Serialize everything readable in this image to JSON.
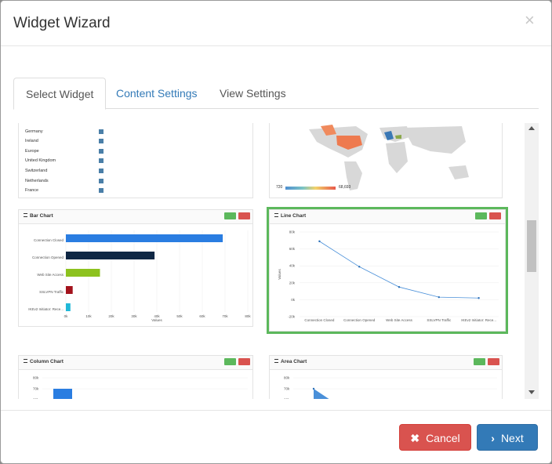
{
  "dialog": {
    "title": "Widget Wizard",
    "close_label": "×"
  },
  "tabs": [
    {
      "label": "Select Widget",
      "active": true
    },
    {
      "label": "Content Settings",
      "active": false
    },
    {
      "label": "View Settings",
      "active": false
    }
  ],
  "widgets": {
    "map_list": {
      "rows": [
        "Germany",
        "Ireland",
        "Europe",
        "United Kingdom",
        "Switzerland",
        "Netherlands",
        "France"
      ]
    },
    "world_map": {
      "legend_min": "720",
      "legend_max": "68,693"
    },
    "bar_chart": {
      "title": "Bar Chart",
      "xlabel": "Values",
      "categories": [
        "Connection Closed",
        "Connection Opened",
        "Web Site Access",
        "SSLVPN Traffic",
        "IKEv2 Initiator: Rece..."
      ],
      "values": [
        69000,
        39000,
        15000,
        3000,
        2000
      ],
      "colors": [
        "#2a7de1",
        "#0f2744",
        "#8dc21f",
        "#a3121c",
        "#20b8d8"
      ],
      "x_ticks": [
        "0k",
        "10k",
        "20k",
        "30k",
        "40k",
        "50k",
        "60k",
        "70k",
        "80k"
      ]
    },
    "line_chart": {
      "title": "Line Chart",
      "ylabel": "Values",
      "categories": [
        "Connection Closed",
        "Connection Opened",
        "Web Site Access",
        "SSLVPN Traffic",
        "IKEv2 Initiator: Rece..."
      ],
      "values": [
        69000,
        39000,
        15000,
        3000,
        2000
      ],
      "y_ticks": [
        "80k",
        "60k",
        "40k",
        "20k",
        "0k",
        "-20k"
      ],
      "color": "#4a90d9"
    },
    "column_chart": {
      "title": "Column Chart",
      "y_ticks": [
        "80k",
        "70k",
        "60k"
      ]
    },
    "area_chart": {
      "title": "Area Chart",
      "y_ticks": [
        "80k",
        "70k",
        "60k"
      ]
    }
  },
  "footer": {
    "cancel_label": "Cancel",
    "cancel_icon": "✖",
    "next_label": "Next",
    "next_icon": "›"
  },
  "colors": {
    "selected_border": "#5cb85c",
    "cancel_bg": "#d9534f",
    "next_bg": "#337ab7"
  }
}
